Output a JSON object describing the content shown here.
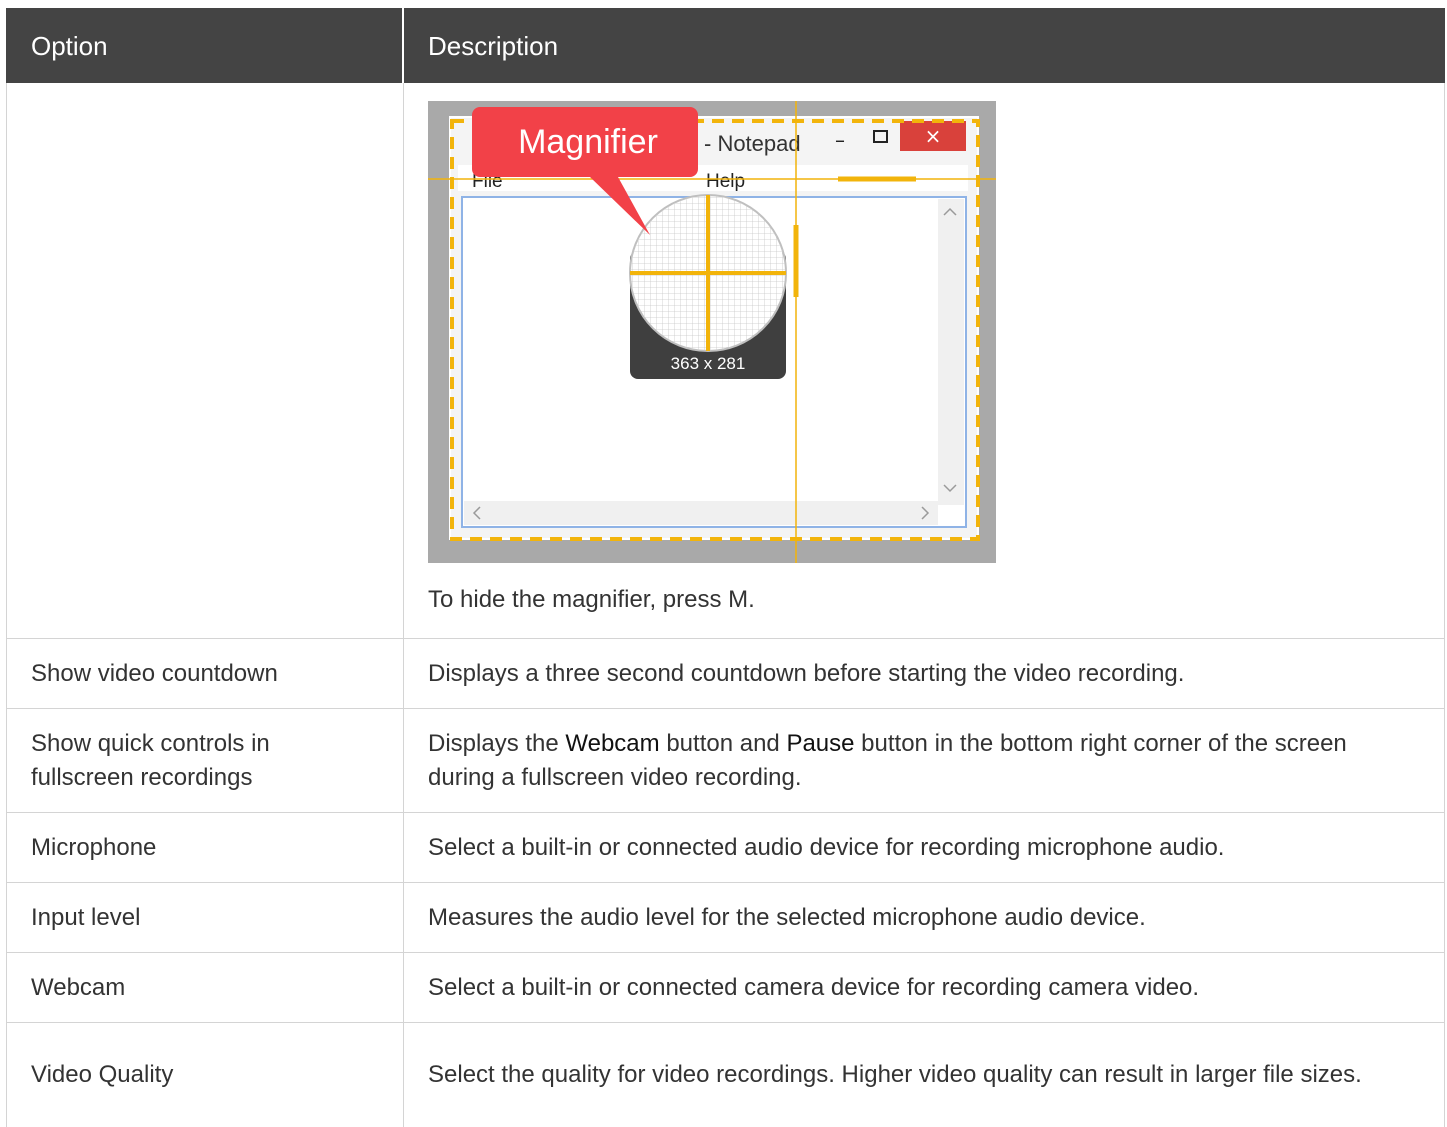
{
  "table": {
    "headers": {
      "option": "Option",
      "description": "Description"
    },
    "magnifier_row": {
      "screenshot": {
        "callout_label": "Magnifier",
        "window_title": "- Notepad",
        "menu_file": "File",
        "menu_help": "Help",
        "dimension_readout": "363 x 281",
        "minimize_glyph": "–",
        "close_glyph": "×",
        "colors": {
          "callout": "#f24148",
          "crosshair": "#f2b40b",
          "close_button": "#d9413b"
        }
      },
      "caption": "To hide the magnifier, press M."
    },
    "rows": [
      {
        "option": "Show video countdown",
        "description": "Displays a three second countdown before starting the video recording."
      },
      {
        "option": "Show quick controls in fullscreen recordings",
        "description_parts": {
          "p1": "Displays the ",
          "webcam": "Webcam",
          "p2": " button and ",
          "pause": "Pause",
          "p3": " button in the bottom right corner of the screen during a fullscreen video recording."
        }
      },
      {
        "option": "Microphone",
        "description": "Select a built-in or connected audio device for recording microphone audio."
      },
      {
        "option": "Input level",
        "description": "Measures the audio level for the selected microphone audio device."
      },
      {
        "option": "Webcam",
        "description": "Select a built-in or connected camera device for recording camera video."
      },
      {
        "option": "Video Quality",
        "description": "Select the quality for video recordings. Higher video quality can result in larger file sizes."
      }
    ]
  }
}
